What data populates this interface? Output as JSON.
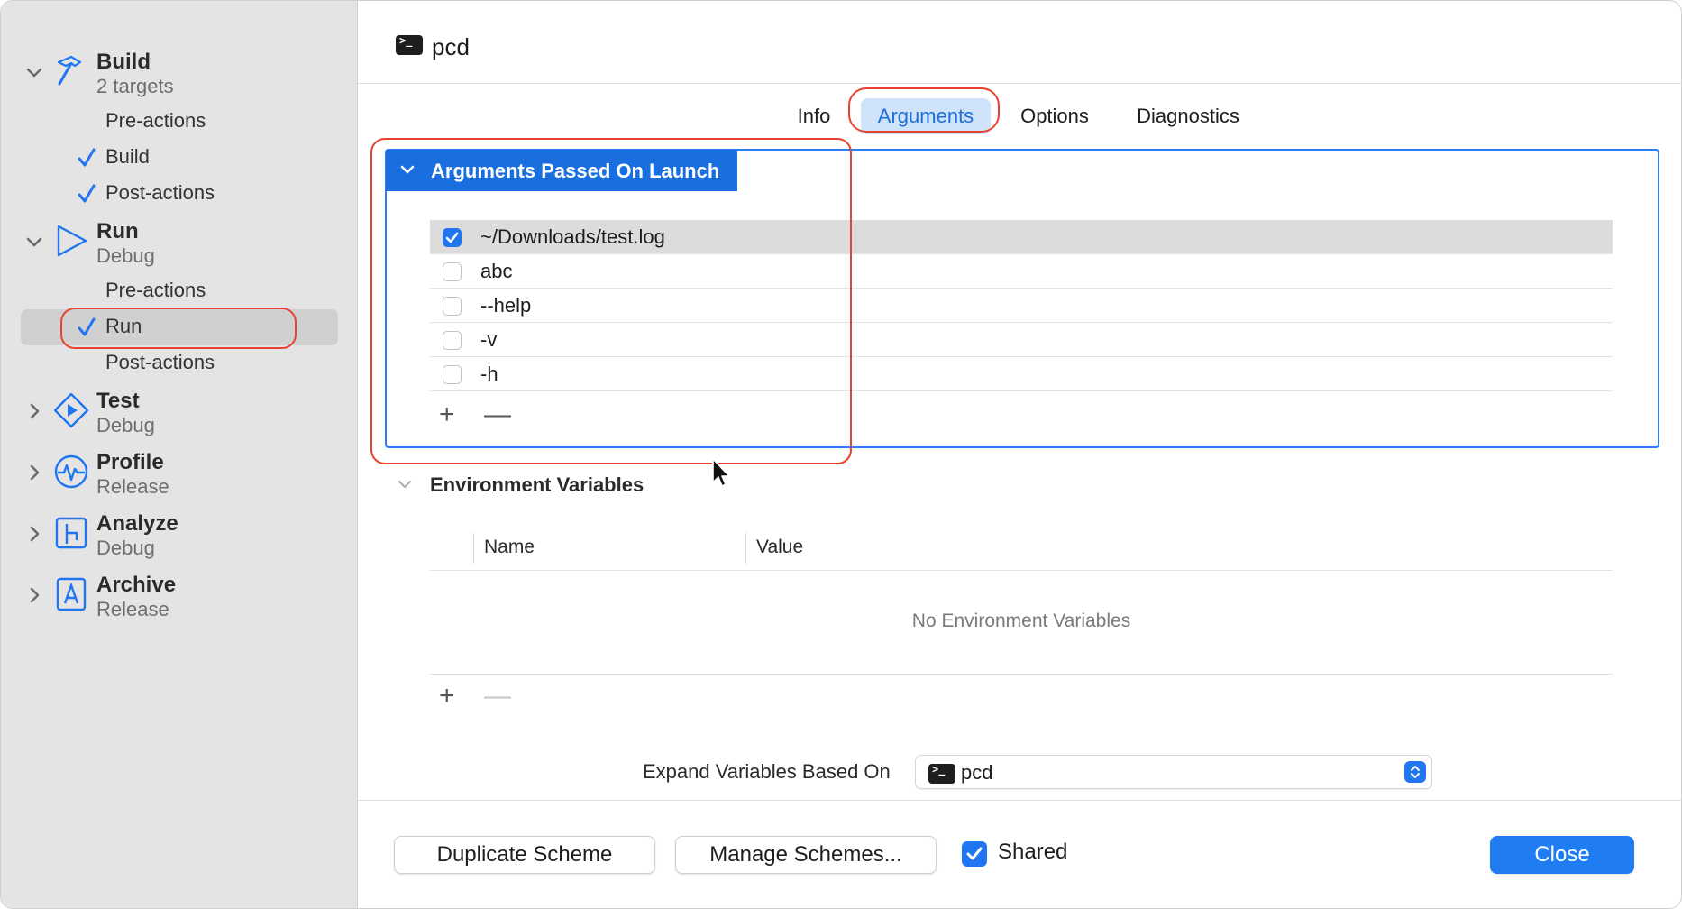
{
  "sidebar": {
    "groups": [
      {
        "title": "Build",
        "subtitle": "2 targets",
        "icon": "hammer-icon",
        "expanded": true
      },
      {
        "title": "Run",
        "subtitle": "Debug",
        "icon": "play-triangle-icon",
        "expanded": true
      },
      {
        "title": "Test",
        "subtitle": "Debug",
        "icon": "diamond-play-icon",
        "expanded": false
      },
      {
        "title": "Profile",
        "subtitle": "Release",
        "icon": "waveform-gauge-icon",
        "expanded": false
      },
      {
        "title": "Analyze",
        "subtitle": "Debug",
        "icon": "branch-analyze-icon",
        "expanded": false
      },
      {
        "title": "Archive",
        "subtitle": "Release",
        "icon": "archive-a-icon",
        "expanded": false
      }
    ],
    "build_items": [
      {
        "label": "Pre-actions",
        "checked": false
      },
      {
        "label": "Build",
        "checked": true
      },
      {
        "label": "Post-actions",
        "checked": true
      }
    ],
    "run_items": [
      {
        "label": "Pre-actions",
        "checked": false
      },
      {
        "label": "Run",
        "checked": true,
        "selected": true
      },
      {
        "label": "Post-actions",
        "checked": false
      }
    ]
  },
  "header": {
    "title": "pcd",
    "icon": "terminal-icon"
  },
  "tabs": [
    {
      "label": "Info",
      "active": false
    },
    {
      "label": "Arguments",
      "active": true
    },
    {
      "label": "Options",
      "active": false
    },
    {
      "label": "Diagnostics",
      "active": false
    }
  ],
  "arguments": {
    "section_title": "Arguments Passed On Launch",
    "rows": [
      {
        "value": "~/Downloads/test.log",
        "checked": true
      },
      {
        "value": "abc",
        "checked": false
      },
      {
        "value": "--help",
        "checked": false
      },
      {
        "value": "-v",
        "checked": false
      },
      {
        "value": "-h",
        "checked": false
      }
    ],
    "add_symbol": "+",
    "remove_symbol": "—"
  },
  "environment": {
    "section_title": "Environment Variables",
    "columns": [
      "Name",
      "Value"
    ],
    "empty_text": "No Environment Variables",
    "add_symbol": "+",
    "remove_symbol": "—"
  },
  "expand": {
    "label": "Expand Variables Based On",
    "selected": "pcd"
  },
  "footer": {
    "duplicate_label": "Duplicate Scheme",
    "manage_label": "Manage Schemes...",
    "shared_label": "Shared",
    "shared_checked": true,
    "close_label": "Close"
  },
  "colors": {
    "accent": "#1f76f0",
    "highlight_ring": "#e8432f",
    "section_header": "#1a6fe0",
    "sidebar_bg": "#e4e4e4"
  }
}
